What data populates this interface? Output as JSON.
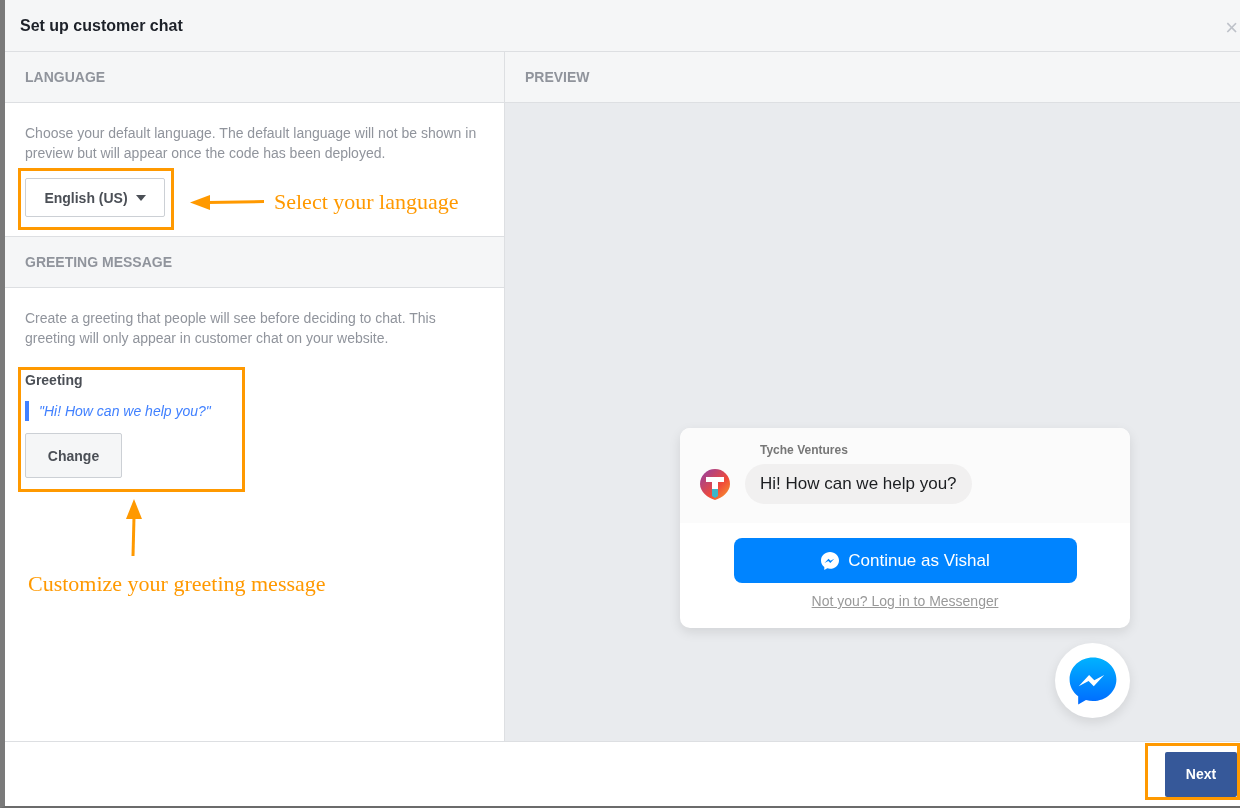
{
  "window": {
    "title": "Set up customer chat",
    "close": "×"
  },
  "language": {
    "heading": "LANGUAGE",
    "description": "Choose your default language. The default language will not be shown in preview but will appear once the code has been deployed.",
    "dropdown": {
      "value": "English (US)"
    }
  },
  "greeting": {
    "heading": "GREETING MESSAGE",
    "description": "Create a greeting that people will see before deciding to chat. This greeting will only appear in customer chat on your website.",
    "label": "Greeting",
    "text": "\"Hi! How can we help you?\"",
    "button": "Change"
  },
  "preview": {
    "heading": "PREVIEW",
    "page_name": "Tyche Ventures",
    "message": "Hi! How can we help you?",
    "continue_button": "Continue as Vishal",
    "login_link": "Not you? Log in to Messenger"
  },
  "footer": {
    "button": "Next"
  },
  "callouts": [
    {
      "text": "Select your language"
    },
    {
      "text": "Customize your greeting message"
    }
  ]
}
